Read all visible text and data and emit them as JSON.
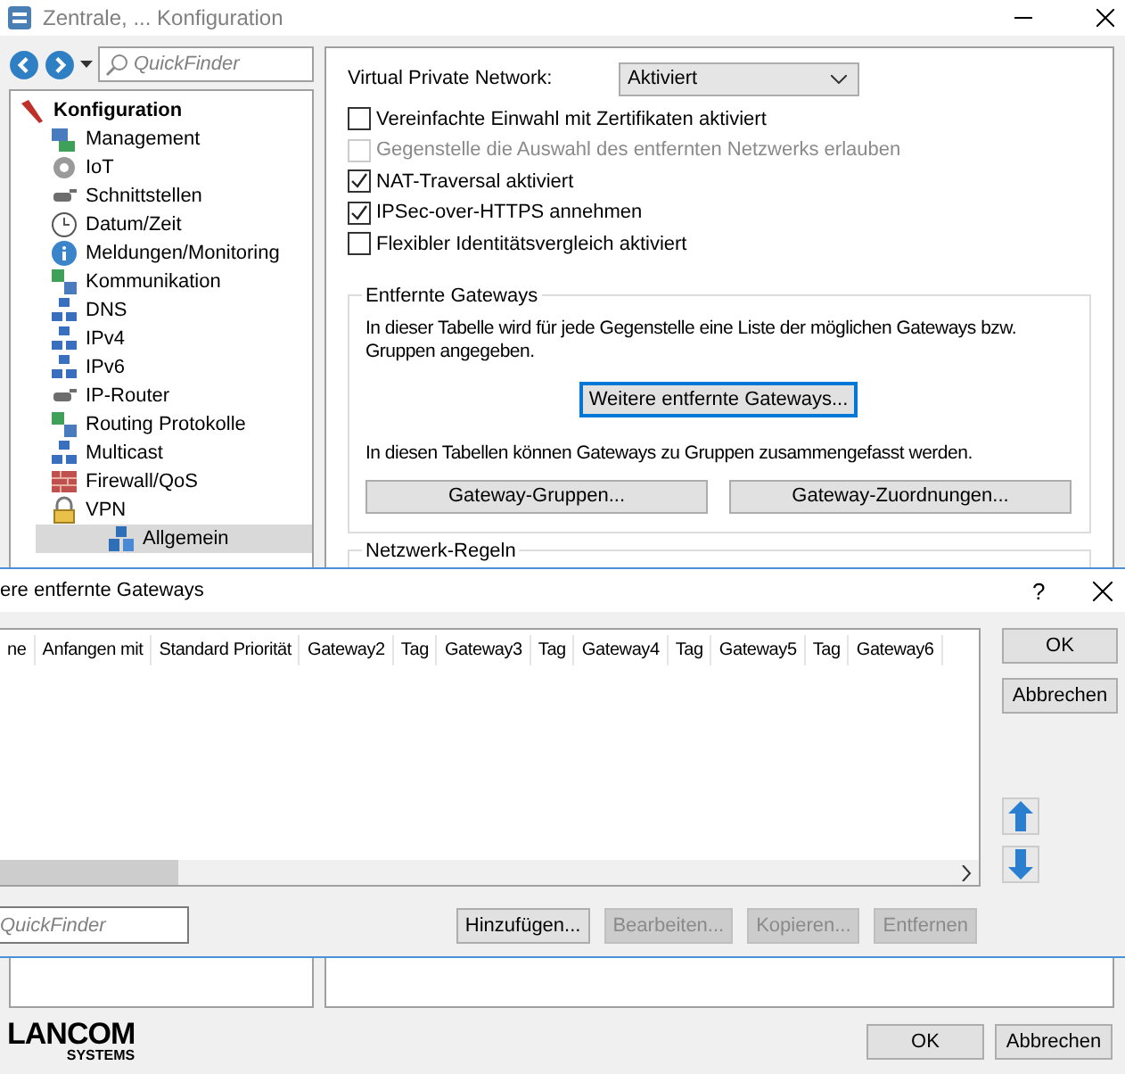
{
  "window": {
    "title": "Zentrale, ... Konfiguration"
  },
  "quickfinder": {
    "placeholder": "QuickFinder"
  },
  "tree": {
    "items": [
      {
        "label": "Konfiguration",
        "selected": false,
        "children": [
          {
            "label": "Management",
            "selected": false
          },
          {
            "label": "IoT",
            "selected": false
          },
          {
            "label": "Schnittstellen",
            "selected": false
          },
          {
            "label": "Datum/Zeit",
            "selected": false
          },
          {
            "label": "Meldungen/Monitoring",
            "selected": false
          },
          {
            "label": "Kommunikation",
            "selected": false
          },
          {
            "label": "DNS",
            "selected": false
          },
          {
            "label": "IPv4",
            "selected": false
          },
          {
            "label": "IPv6",
            "selected": false
          },
          {
            "label": "IP-Router",
            "selected": false
          },
          {
            "label": "Routing Protokolle",
            "selected": false
          },
          {
            "label": "Multicast",
            "selected": false
          },
          {
            "label": "Firewall/QoS",
            "selected": false
          },
          {
            "label": "VPN",
            "selected": false,
            "children": [
              {
                "label": "Allgemein",
                "selected": true
              }
            ]
          }
        ]
      }
    ]
  },
  "settings": {
    "vpn": {
      "label": "Virtual Private Network:",
      "value": "Aktiviert"
    },
    "options": [
      {
        "label": "Vereinfachte Einwahl mit Zertifikaten aktiviert",
        "checked": false,
        "disabled": false
      },
      {
        "label": "Gegenstelle die Auswahl des entfernten Netzwerks erlauben",
        "checked": false,
        "disabled": true
      },
      {
        "label": "NAT-Traversal aktiviert",
        "checked": true,
        "disabled": false
      },
      {
        "label": "IPSec-over-HTTPS annehmen",
        "checked": true,
        "disabled": false
      },
      {
        "label": "Flexibler Identitätsvergleich aktiviert",
        "checked": false,
        "disabled": false
      }
    ]
  },
  "remote_gateways": {
    "title": "Entfernte Gateways",
    "text": "In dieser Tabelle wird für jede Gegenstelle eine Liste der möglichen Gateways bzw. Gruppen angegeben.",
    "button": "Weitere entfernte Gateways...",
    "text2": "In diesen Tabellen können Gateways zu Gruppen zusammengefasst werden.",
    "buttons": [
      "Gateway-Gruppen...",
      "Gateway-Zuordnungen..."
    ]
  },
  "network_rules": {
    "title": "Netzwerk-Regeln"
  },
  "logo": {
    "name": "LANCOM",
    "sub": "SYSTEMS"
  },
  "footer": {
    "buttons": [
      "OK",
      "Abbrechen"
    ]
  },
  "dialog": {
    "title": "ere entfernte Gateways",
    "help": "?",
    "columns": [
      "ne",
      "Anfangen mit",
      "Standard Priorität",
      "Gateway2",
      "Tag",
      "Gateway3",
      "Tag",
      "Gateway4",
      "Tag",
      "Gateway5",
      "Tag",
      "Gateway6"
    ],
    "side_buttons": [
      "OK",
      "Abbrechen"
    ],
    "quickfinder": {
      "placeholder": "QuickFinder"
    },
    "actions": [
      {
        "label": "Hinzufügen...",
        "disabled": false
      },
      {
        "label": "Bearbeiten...",
        "disabled": true
      },
      {
        "label": "Kopieren...",
        "disabled": true
      },
      {
        "label": "Entfernen",
        "disabled": true
      }
    ]
  }
}
